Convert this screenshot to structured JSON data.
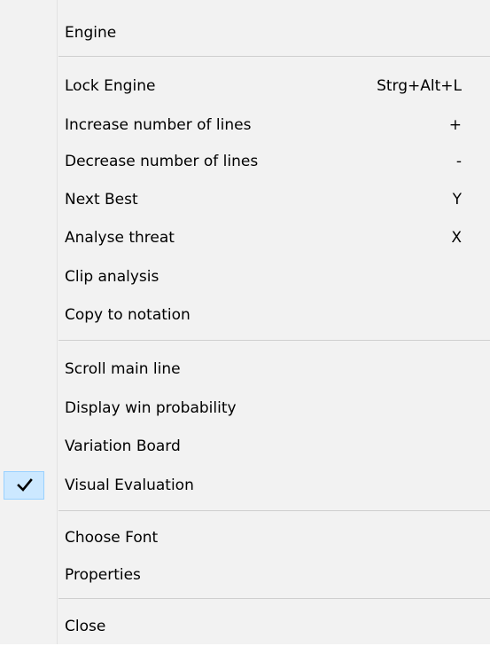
{
  "menu": {
    "engine": {
      "label": "Engine"
    },
    "lock_engine": {
      "label": "Lock Engine",
      "shortcut": "Strg+Alt+L"
    },
    "increase_lines": {
      "label": "Increase number of lines",
      "shortcut": "+"
    },
    "decrease_lines": {
      "label": "Decrease number of lines",
      "shortcut": "-"
    },
    "next_best": {
      "label": "Next Best",
      "shortcut": "Y"
    },
    "analyse_threat": {
      "label": "Analyse threat",
      "shortcut": "X"
    },
    "clip_analysis": {
      "label": "Clip analysis"
    },
    "copy_to_notation": {
      "label": "Copy to notation"
    },
    "scroll_main_line": {
      "label": "Scroll main line"
    },
    "display_win_probability": {
      "label": "Display win probability"
    },
    "variation_board": {
      "label": "Variation Board"
    },
    "visual_evaluation": {
      "label": "Visual Evaluation",
      "checked": true
    },
    "choose_font": {
      "label": "Choose Font"
    },
    "properties": {
      "label": "Properties"
    },
    "close": {
      "label": "Close"
    }
  },
  "icons": {
    "checkmark": "checkmark-icon"
  },
  "colors": {
    "menu_background": "#f2f2f2",
    "check_highlight": "#cce8ff",
    "check_border": "#99d1ff",
    "separator": "#cfcfcf",
    "text": "#000000"
  }
}
